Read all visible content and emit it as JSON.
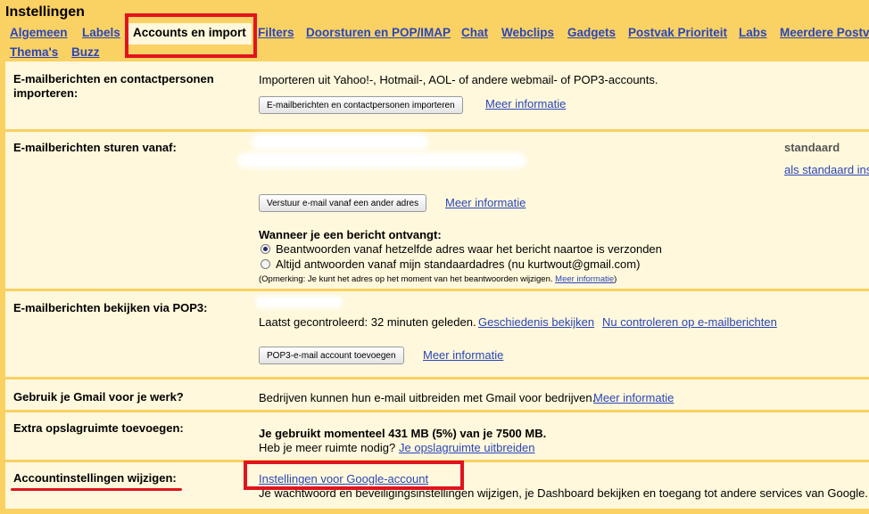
{
  "title": "Instellingen",
  "tabs": [
    {
      "label": "Algemeen"
    },
    {
      "label": "Labels"
    },
    {
      "label": "Accounts en import"
    },
    {
      "label": "Filters"
    },
    {
      "label": "Doorsturen en POP/IMAP"
    },
    {
      "label": "Chat"
    },
    {
      "label": "Webclips"
    },
    {
      "label": "Gadgets"
    },
    {
      "label": "Postvak Prioriteit"
    },
    {
      "label": "Labs"
    },
    {
      "label": "Meerdere Postv"
    },
    {
      "label": "Thema's"
    },
    {
      "label": "Buzz"
    }
  ],
  "import": {
    "label": "E-mailberichten en contactpersonen importeren:",
    "description": "Importeren uit Yahoo!-, Hotmail-, AOL- of andere webmail- of POP3-accounts.",
    "button": "E-mailberichten en contactpersonen importeren",
    "more_info": "Meer informatie"
  },
  "send_from": {
    "label": "E-mailberichten sturen vanaf:",
    "default_label": "standaard",
    "make_default": "als standaard ins",
    "button": "Verstuur e-mail vanaf een ander adres",
    "more_info": "Meer informatie",
    "reply_heading": "Wanneer je een bericht ontvangt:",
    "reply_options": [
      {
        "label": "Beantwoorden vanaf hetzelfde adres waar het bericht naartoe is verzonden",
        "checked": true
      },
      {
        "label": "Altijd antwoorden vanaf mijn standaardadres (nu kurtwout@gmail.com)",
        "checked": false
      }
    ],
    "note": "(Opmerking: Je kunt het adres op het moment van het beantwoorden wijzigen.",
    "note_link": "Meer informatie",
    "note_end": ")"
  },
  "pop3": {
    "label": "E-mailberichten bekijken via POP3:",
    "last_checked": "Laatst gecontroleerd: 32 minuten geleden.",
    "history_link": "Geschiedenis bekijken",
    "check_now_link": "Nu controleren op e-mailberichten",
    "button": "POP3-e-mail account toevoegen",
    "more_info": "Meer informatie"
  },
  "work": {
    "label": "Gebruik je Gmail voor je werk?",
    "description": "Bedrijven kunnen hun e-mail uitbreiden met Gmail voor bedrijven.",
    "more_info": "Meer informatie"
  },
  "storage": {
    "label": "Extra opslagruimte toevoegen:",
    "usage": "Je gebruikt momenteel 431 MB (5%) van je 7500 MB.",
    "question": "Heb je meer ruimte nodig?",
    "link": "Je opslagruimte uitbreiden"
  },
  "account": {
    "label": "Accountinstellingen wijzigen:",
    "link": "Instellingen voor Google-account",
    "description": "Je wachtwoord en beveiligingsinstellingen wijzigen, je Dashboard bekijken en toegang tot andere services van Google."
  },
  "colors": {
    "background": "#fad163",
    "panel": "#fff8dc",
    "link": "#2a46b8",
    "highlight": "#e0141e"
  }
}
